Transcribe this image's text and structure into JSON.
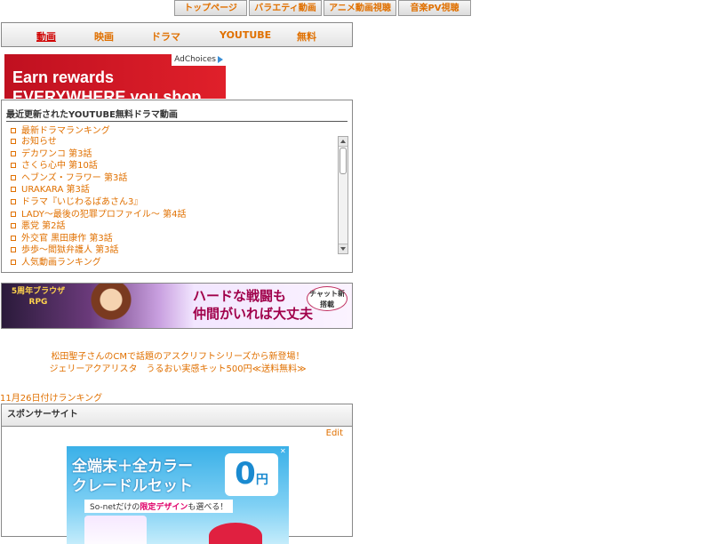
{
  "top_tabs": [
    "トップページ",
    "バラエティ動画",
    "アニメ動画視聴",
    "音楽PV視聴"
  ],
  "nav": [
    "動画",
    "映画",
    "ドラマ",
    "YOUTUBE",
    "無料"
  ],
  "ad_banner_1": {
    "line1": "Earn rewards",
    "line2": "EVERYWHERE you shop",
    "adchoices": "AdChoices"
  },
  "recent": {
    "title": "最近更新されたYOUTUBE無料ドラマ動画",
    "top_link": "最新ドラマランキング",
    "items": [
      "お知らせ",
      "デカワンコ 第3話",
      "さくら心中 第10話",
      "ヘブンズ・フラワー 第3話",
      "URAKARA 第3話",
      "ドラマ『いじわるばあさん3』",
      "LADY～最後の犯罪プロファイル～ 第4話",
      "悪党 第2話",
      "外交官 黒田康作 第3話",
      "歩歩～閻獄弁護人 第3話"
    ],
    "bottom_link": "人気動画ランキング"
  },
  "ad_banner_2": {
    "logo": "5周年ブラウザRPG",
    "line1": "ハードな戦闘も",
    "line2": "仲間がいれば大丈夫",
    "badge": "チャット新搭載"
  },
  "promo": {
    "line1": "松田聖子さんのCMで話題のアスクリフトシリーズから新登場！",
    "line2": "ジェリーアクアリスタ　うるおい実感キット500円≪送料無料≫"
  },
  "ranking_link": "11月26日付けランキング",
  "sponsor": {
    "title": "スポンサーサイト",
    "edit": "Edit",
    "ad_line1": "全端末＋全カラー",
    "ad_line2": "クレードルセット",
    "ad_price": "0",
    "ad_price_unit": "円",
    "ad_sub_prefix": "So-netだけの",
    "ad_sub_highlight": "限定デザイン",
    "ad_sub_suffix": "も選べる！"
  }
}
